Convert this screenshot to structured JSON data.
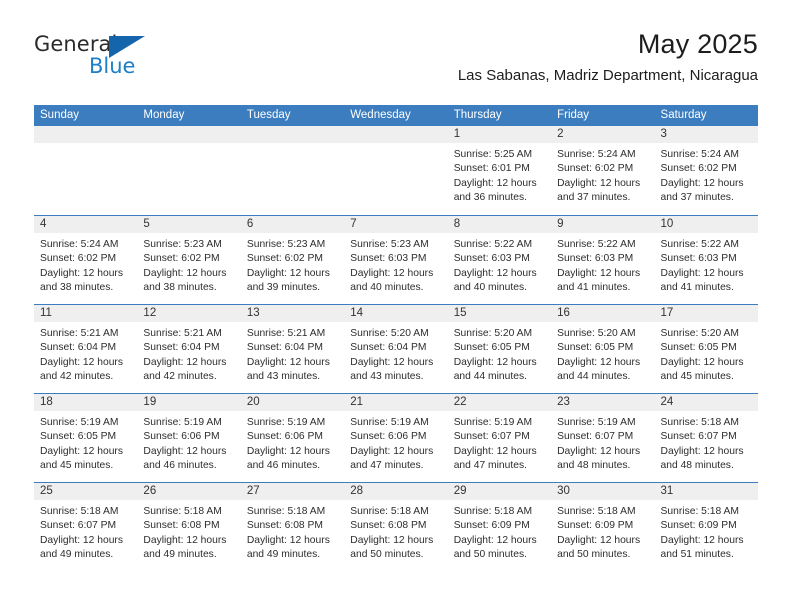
{
  "brand": {
    "name_top": "General",
    "name_bottom": "Blue",
    "flag_color": "#1565ad",
    "blue_text_color": "#1e7ec8"
  },
  "header": {
    "title": "May 2025",
    "subtitle": "Las Sabanas, Madriz Department, Nicaragua"
  },
  "theme": {
    "header_bar_color": "#3b7dbf",
    "day_number_band_color": "#efefef",
    "grid_line_color": "#3b7dbf"
  },
  "weekdays": [
    "Sunday",
    "Monday",
    "Tuesday",
    "Wednesday",
    "Thursday",
    "Friday",
    "Saturday"
  ],
  "weeks": [
    [
      {
        "day": "",
        "lines": []
      },
      {
        "day": "",
        "lines": []
      },
      {
        "day": "",
        "lines": []
      },
      {
        "day": "",
        "lines": []
      },
      {
        "day": "1",
        "lines": [
          "Sunrise: 5:25 AM",
          "Sunset: 6:01 PM",
          "Daylight: 12 hours",
          "and 36 minutes."
        ]
      },
      {
        "day": "2",
        "lines": [
          "Sunrise: 5:24 AM",
          "Sunset: 6:02 PM",
          "Daylight: 12 hours",
          "and 37 minutes."
        ]
      },
      {
        "day": "3",
        "lines": [
          "Sunrise: 5:24 AM",
          "Sunset: 6:02 PM",
          "Daylight: 12 hours",
          "and 37 minutes."
        ]
      }
    ],
    [
      {
        "day": "4",
        "lines": [
          "Sunrise: 5:24 AM",
          "Sunset: 6:02 PM",
          "Daylight: 12 hours",
          "and 38 minutes."
        ]
      },
      {
        "day": "5",
        "lines": [
          "Sunrise: 5:23 AM",
          "Sunset: 6:02 PM",
          "Daylight: 12 hours",
          "and 38 minutes."
        ]
      },
      {
        "day": "6",
        "lines": [
          "Sunrise: 5:23 AM",
          "Sunset: 6:02 PM",
          "Daylight: 12 hours",
          "and 39 minutes."
        ]
      },
      {
        "day": "7",
        "lines": [
          "Sunrise: 5:23 AM",
          "Sunset: 6:03 PM",
          "Daylight: 12 hours",
          "and 40 minutes."
        ]
      },
      {
        "day": "8",
        "lines": [
          "Sunrise: 5:22 AM",
          "Sunset: 6:03 PM",
          "Daylight: 12 hours",
          "and 40 minutes."
        ]
      },
      {
        "day": "9",
        "lines": [
          "Sunrise: 5:22 AM",
          "Sunset: 6:03 PM",
          "Daylight: 12 hours",
          "and 41 minutes."
        ]
      },
      {
        "day": "10",
        "lines": [
          "Sunrise: 5:22 AM",
          "Sunset: 6:03 PM",
          "Daylight: 12 hours",
          "and 41 minutes."
        ]
      }
    ],
    [
      {
        "day": "11",
        "lines": [
          "Sunrise: 5:21 AM",
          "Sunset: 6:04 PM",
          "Daylight: 12 hours",
          "and 42 minutes."
        ]
      },
      {
        "day": "12",
        "lines": [
          "Sunrise: 5:21 AM",
          "Sunset: 6:04 PM",
          "Daylight: 12 hours",
          "and 42 minutes."
        ]
      },
      {
        "day": "13",
        "lines": [
          "Sunrise: 5:21 AM",
          "Sunset: 6:04 PM",
          "Daylight: 12 hours",
          "and 43 minutes."
        ]
      },
      {
        "day": "14",
        "lines": [
          "Sunrise: 5:20 AM",
          "Sunset: 6:04 PM",
          "Daylight: 12 hours",
          "and 43 minutes."
        ]
      },
      {
        "day": "15",
        "lines": [
          "Sunrise: 5:20 AM",
          "Sunset: 6:05 PM",
          "Daylight: 12 hours",
          "and 44 minutes."
        ]
      },
      {
        "day": "16",
        "lines": [
          "Sunrise: 5:20 AM",
          "Sunset: 6:05 PM",
          "Daylight: 12 hours",
          "and 44 minutes."
        ]
      },
      {
        "day": "17",
        "lines": [
          "Sunrise: 5:20 AM",
          "Sunset: 6:05 PM",
          "Daylight: 12 hours",
          "and 45 minutes."
        ]
      }
    ],
    [
      {
        "day": "18",
        "lines": [
          "Sunrise: 5:19 AM",
          "Sunset: 6:05 PM",
          "Daylight: 12 hours",
          "and 45 minutes."
        ]
      },
      {
        "day": "19",
        "lines": [
          "Sunrise: 5:19 AM",
          "Sunset: 6:06 PM",
          "Daylight: 12 hours",
          "and 46 minutes."
        ]
      },
      {
        "day": "20",
        "lines": [
          "Sunrise: 5:19 AM",
          "Sunset: 6:06 PM",
          "Daylight: 12 hours",
          "and 46 minutes."
        ]
      },
      {
        "day": "21",
        "lines": [
          "Sunrise: 5:19 AM",
          "Sunset: 6:06 PM",
          "Daylight: 12 hours",
          "and 47 minutes."
        ]
      },
      {
        "day": "22",
        "lines": [
          "Sunrise: 5:19 AM",
          "Sunset: 6:07 PM",
          "Daylight: 12 hours",
          "and 47 minutes."
        ]
      },
      {
        "day": "23",
        "lines": [
          "Sunrise: 5:19 AM",
          "Sunset: 6:07 PM",
          "Daylight: 12 hours",
          "and 48 minutes."
        ]
      },
      {
        "day": "24",
        "lines": [
          "Sunrise: 5:18 AM",
          "Sunset: 6:07 PM",
          "Daylight: 12 hours",
          "and 48 minutes."
        ]
      }
    ],
    [
      {
        "day": "25",
        "lines": [
          "Sunrise: 5:18 AM",
          "Sunset: 6:07 PM",
          "Daylight: 12 hours",
          "and 49 minutes."
        ]
      },
      {
        "day": "26",
        "lines": [
          "Sunrise: 5:18 AM",
          "Sunset: 6:08 PM",
          "Daylight: 12 hours",
          "and 49 minutes."
        ]
      },
      {
        "day": "27",
        "lines": [
          "Sunrise: 5:18 AM",
          "Sunset: 6:08 PM",
          "Daylight: 12 hours",
          "and 49 minutes."
        ]
      },
      {
        "day": "28",
        "lines": [
          "Sunrise: 5:18 AM",
          "Sunset: 6:08 PM",
          "Daylight: 12 hours",
          "and 50 minutes."
        ]
      },
      {
        "day": "29",
        "lines": [
          "Sunrise: 5:18 AM",
          "Sunset: 6:09 PM",
          "Daylight: 12 hours",
          "and 50 minutes."
        ]
      },
      {
        "day": "30",
        "lines": [
          "Sunrise: 5:18 AM",
          "Sunset: 6:09 PM",
          "Daylight: 12 hours",
          "and 50 minutes."
        ]
      },
      {
        "day": "31",
        "lines": [
          "Sunrise: 5:18 AM",
          "Sunset: 6:09 PM",
          "Daylight: 12 hours",
          "and 51 minutes."
        ]
      }
    ]
  ]
}
